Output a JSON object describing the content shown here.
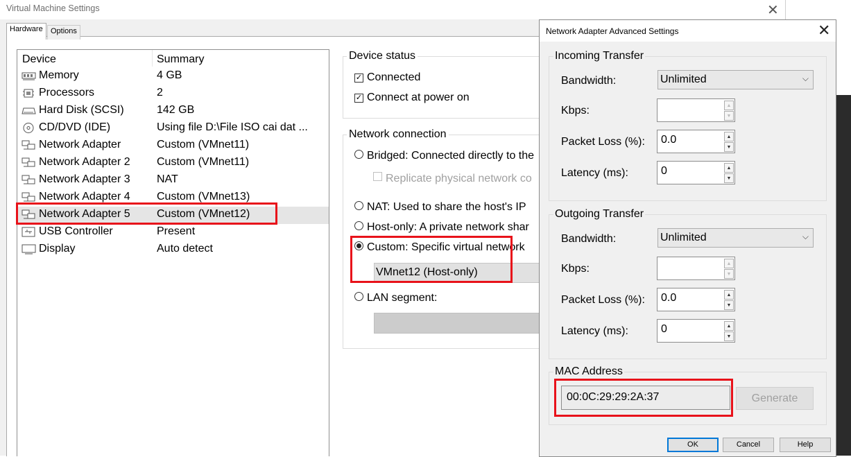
{
  "main": {
    "title": "Virtual Machine Settings",
    "tabs": [
      "Hardware",
      "Options"
    ],
    "device_list": {
      "headers": [
        "Device",
        "Summary"
      ],
      "rows": [
        {
          "icon": "memory-icon",
          "name": "Memory",
          "summary": "4 GB"
        },
        {
          "icon": "processor-icon",
          "name": "Processors",
          "summary": "2"
        },
        {
          "icon": "hard-disk-icon",
          "name": "Hard Disk (SCSI)",
          "summary": "142 GB"
        },
        {
          "icon": "cd-dvd-icon",
          "name": "CD/DVD (IDE)",
          "summary": "Using file D:\\File ISO cai dat ..."
        },
        {
          "icon": "network-adapter-icon",
          "name": "Network Adapter",
          "summary": "Custom (VMnet11)"
        },
        {
          "icon": "network-adapter-icon",
          "name": "Network Adapter 2",
          "summary": "Custom (VMnet11)"
        },
        {
          "icon": "network-adapter-icon",
          "name": "Network Adapter 3",
          "summary": "NAT"
        },
        {
          "icon": "network-adapter-icon",
          "name": "Network Adapter 4",
          "summary": "Custom (VMnet13)"
        },
        {
          "icon": "network-adapter-icon",
          "name": "Network Adapter 5",
          "summary": "Custom (VMnet12)"
        },
        {
          "icon": "usb-icon",
          "name": "USB Controller",
          "summary": "Present"
        },
        {
          "icon": "display-icon",
          "name": "Display",
          "summary": "Auto detect"
        }
      ]
    },
    "device_status": {
      "title": "Device status",
      "connected": "Connected",
      "connect_at_power_on": "Connect at power on"
    },
    "network_connection": {
      "title": "Network connection",
      "bridged": "Bridged: Connected directly to the",
      "replicate": "Replicate physical network co",
      "nat": "NAT: Used to share the host's IP",
      "host_only": "Host-only: A private network shar",
      "custom": "Custom: Specific virtual network",
      "custom_value": "VMnet12 (Host-only)",
      "lan_segment": "LAN segment:"
    }
  },
  "dialog": {
    "title": "Network Adapter Advanced Settings",
    "incoming": {
      "title": "Incoming Transfer",
      "bandwidth_label": "Bandwidth:",
      "bandwidth_value": "Unlimited",
      "kbps_label": "Kbps:",
      "kbps_value": "",
      "packet_loss_label": "Packet Loss (%):",
      "packet_loss_value": "0.0",
      "latency_label": "Latency (ms):",
      "latency_value": "0"
    },
    "outgoing": {
      "title": "Outgoing Transfer",
      "bandwidth_label": "Bandwidth:",
      "bandwidth_value": "Unlimited",
      "kbps_label": "Kbps:",
      "kbps_value": "",
      "packet_loss_label": "Packet Loss (%):",
      "packet_loss_value": "0.0",
      "latency_label": "Latency (ms):",
      "latency_value": "0"
    },
    "mac": {
      "title": "MAC Address",
      "value": "00:0C:29:29:2A:37",
      "generate_label": "Generate"
    },
    "buttons": {
      "ok": "OK",
      "cancel": "Cancel",
      "help": "Help"
    }
  },
  "colors": {
    "highlight": "#e8121a",
    "selected_row": "#e5e5e5",
    "default_button_border": "#0078d7"
  }
}
